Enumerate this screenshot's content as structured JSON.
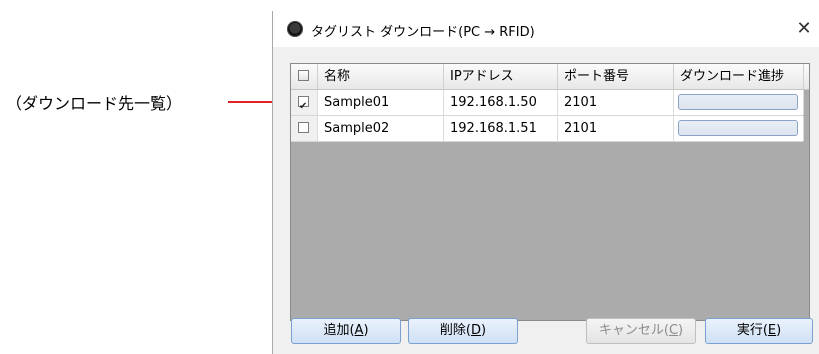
{
  "callout": {
    "label": "（ダウンロード先一覧）"
  },
  "window": {
    "title": "タグリスト ダウンロード(PC → RFID)",
    "close_glyph": "✕"
  },
  "grid": {
    "columns": [
      "名称",
      "IPアドレス",
      "ポート番号",
      "ダウンロード進捗"
    ],
    "rows": [
      {
        "checked": true,
        "name": "Sample01",
        "ip": "192.168.1.50",
        "port": "2101",
        "progress": 0
      },
      {
        "checked": false,
        "name": "Sample02",
        "ip": "192.168.1.51",
        "port": "2101",
        "progress": 0
      }
    ]
  },
  "buttons": {
    "add": {
      "label": "追加(",
      "key": "A",
      "suffix": ")"
    },
    "delete": {
      "label": "削除(",
      "key": "D",
      "suffix": ")"
    },
    "cancel": {
      "label": "キャンセル(",
      "key": "C",
      "suffix": ")"
    },
    "run": {
      "label": "実行(",
      "key": "E",
      "suffix": ")"
    }
  },
  "colors": {
    "callout_line": "#e0232a",
    "grid_background": "#ababab",
    "button_border": "#7aa1d2"
  }
}
